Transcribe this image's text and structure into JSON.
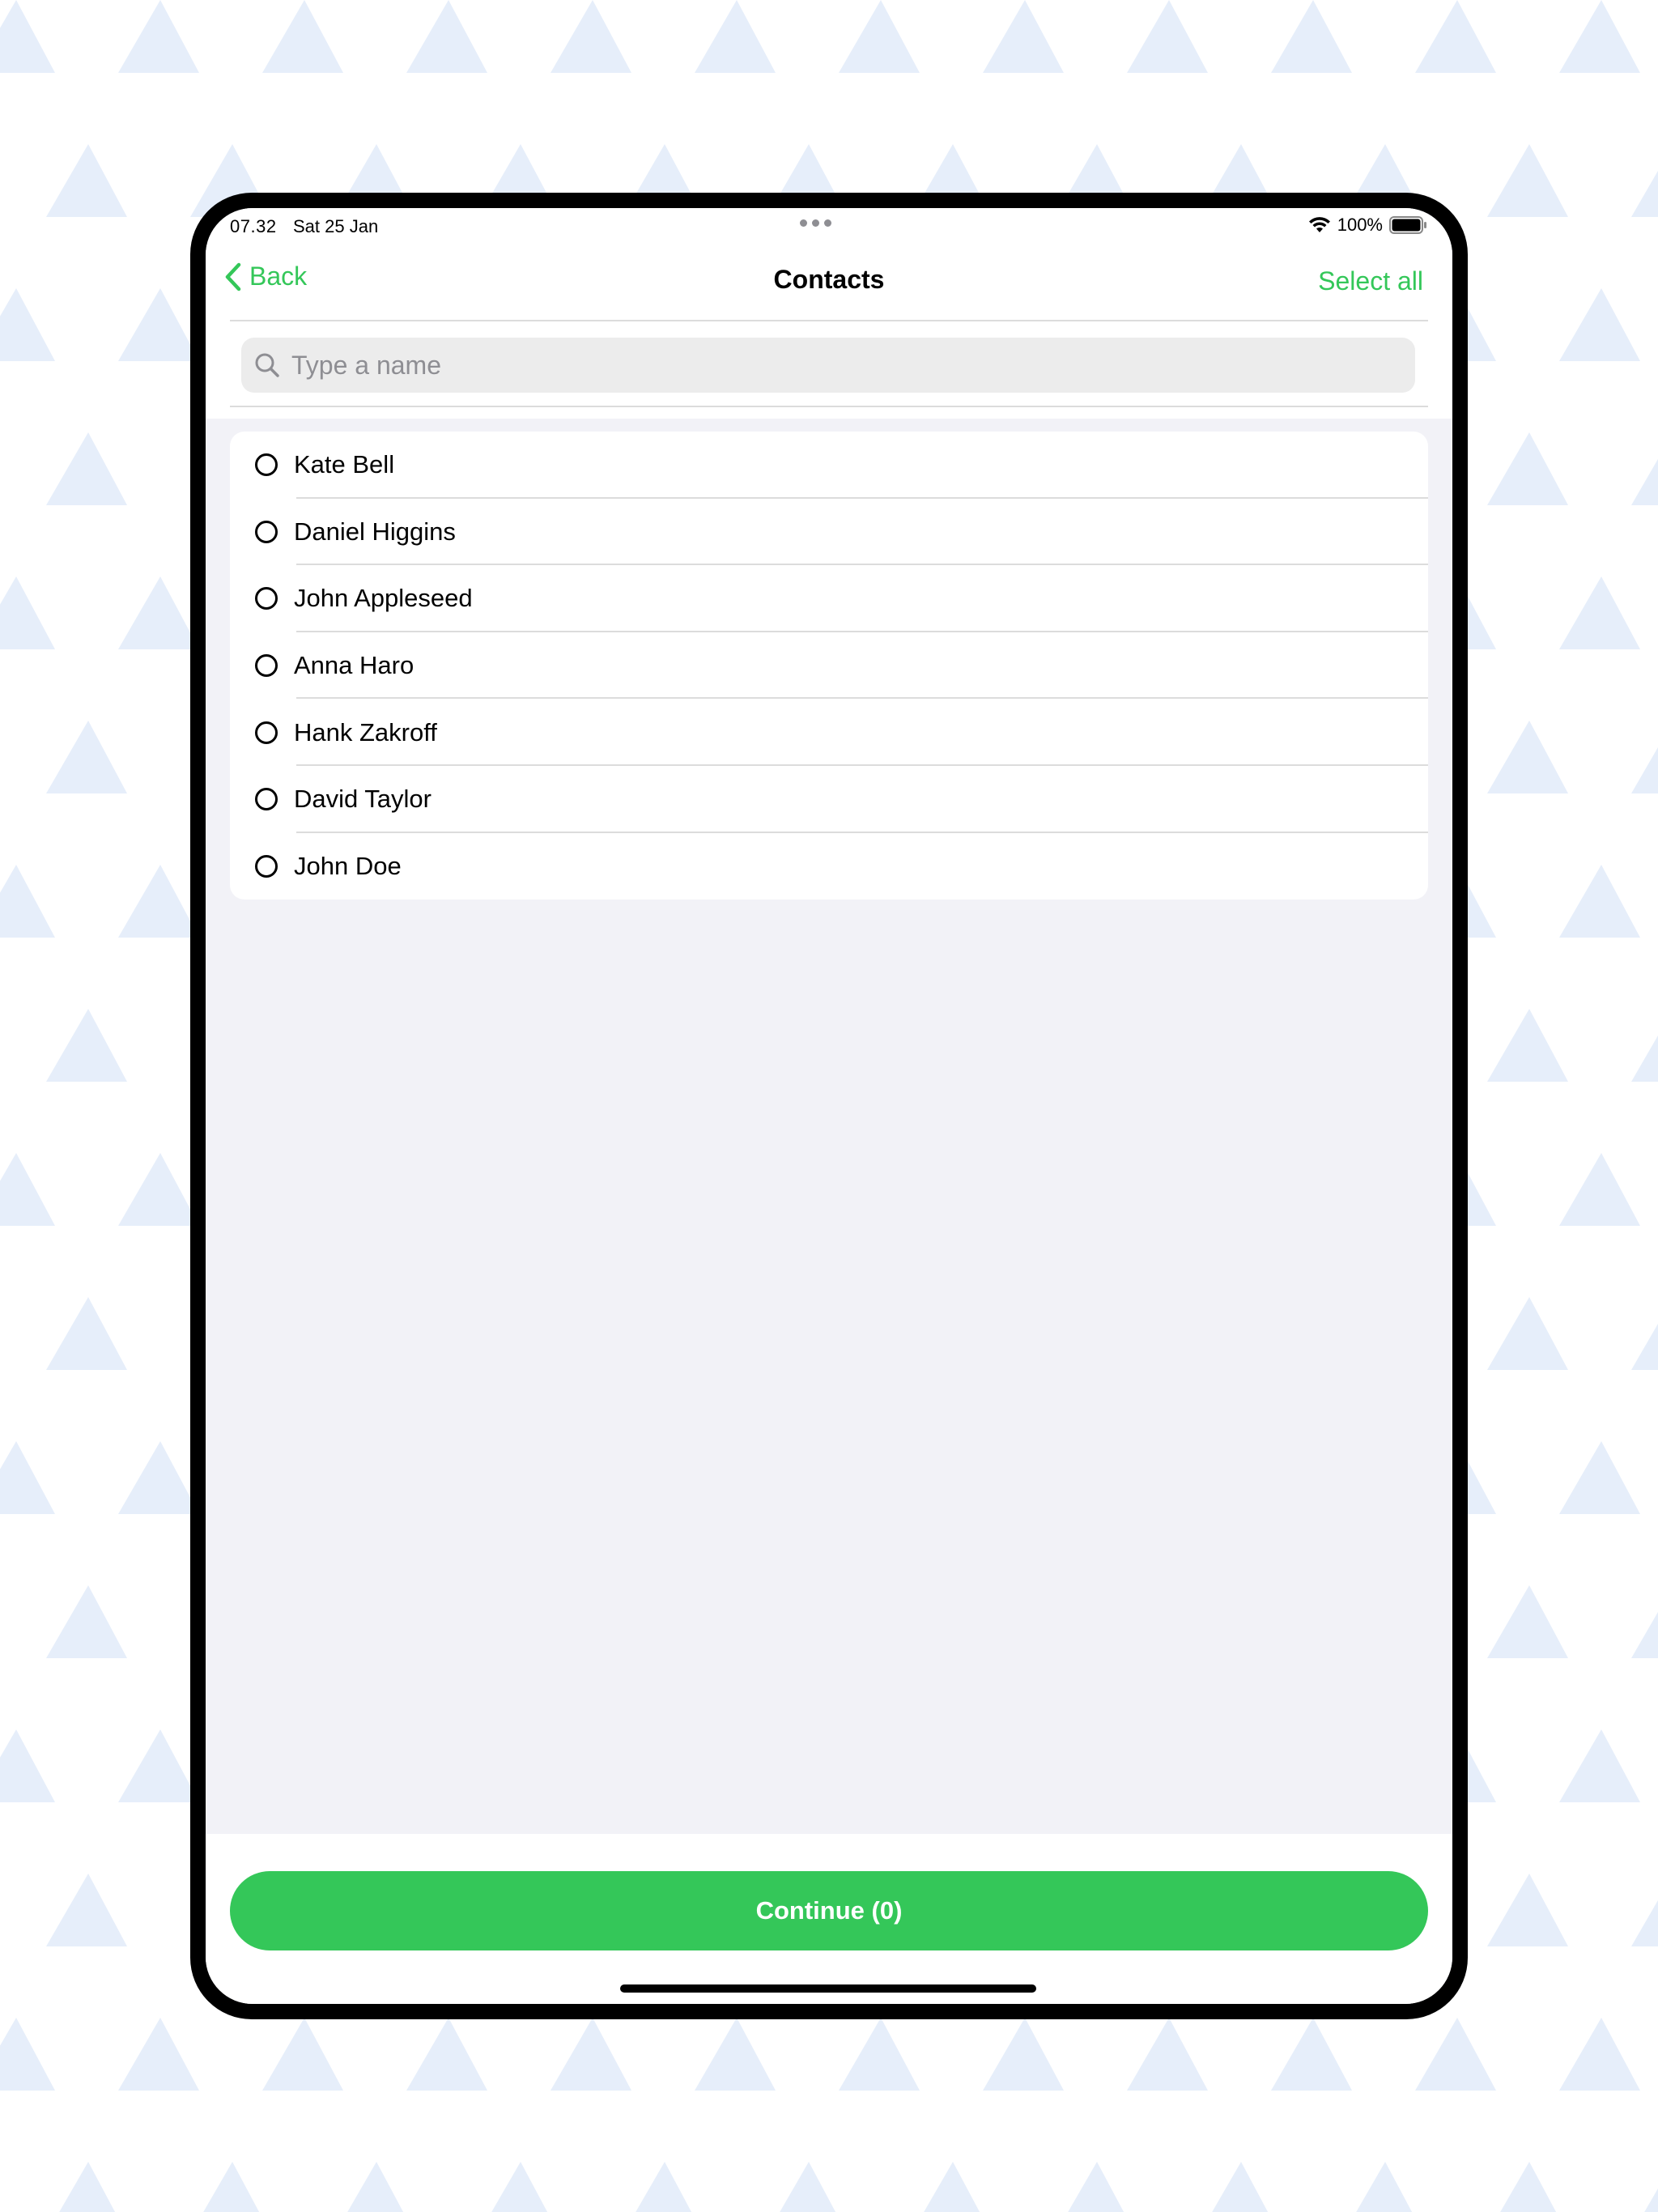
{
  "status_bar": {
    "time": "07.32",
    "date": "Sat 25 Jan",
    "battery": "100%"
  },
  "nav": {
    "back_label": "Back",
    "title": "Contacts",
    "select_all_label": "Select all"
  },
  "search": {
    "placeholder": "Type a name",
    "value": ""
  },
  "contacts": [
    {
      "name": "Kate Bell"
    },
    {
      "name": "Daniel Higgins"
    },
    {
      "name": "John Appleseed"
    },
    {
      "name": "Anna Haro"
    },
    {
      "name": "Hank Zakroff"
    },
    {
      "name": "David Taylor"
    },
    {
      "name": "John Doe"
    }
  ],
  "footer": {
    "continue_label": "Continue (0)"
  },
  "colors": {
    "accent": "#34c759",
    "background_pattern": "#e6eefa",
    "list_background": "#f2f2f7"
  }
}
